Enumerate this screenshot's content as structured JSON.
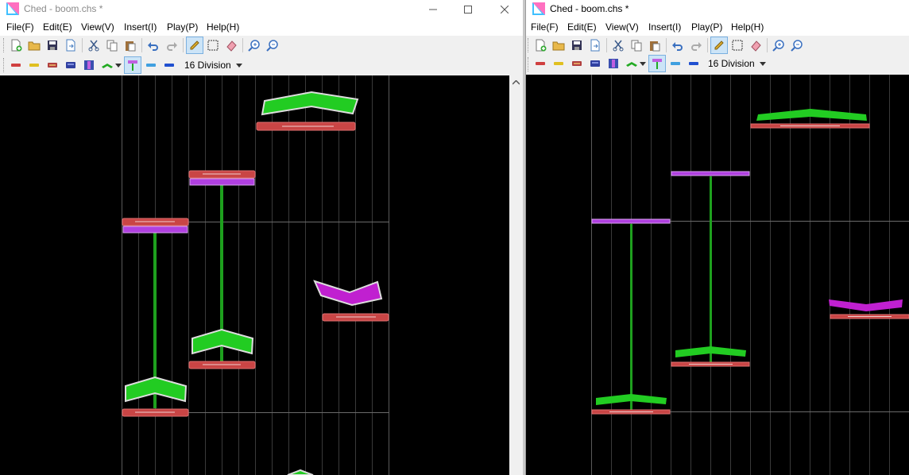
{
  "left": {
    "title": "Ched - boom.chs *",
    "menus": [
      "File(F)",
      "Edit(E)",
      "View(V)",
      "Insert(I)",
      "Play(P)",
      "Help(H)"
    ],
    "division": "16 Division"
  },
  "right": {
    "title": "Ched - boom.chs *",
    "menus": [
      "File(F)",
      "Edit(E)",
      "View(V)",
      "Insert(I)",
      "Play(P)",
      "Help(H)"
    ],
    "division": "16 Division"
  },
  "icons": {
    "toolbar": [
      "new-file-icon",
      "open-folder-icon",
      "save-icon",
      "export-icon",
      "cut-icon",
      "copy-icon",
      "paste-icon",
      "undo-icon",
      "redo-icon",
      "pencil-icon",
      "select-rect-icon",
      "eraser-icon",
      "zoom-in-icon",
      "zoom-out-icon"
    ],
    "notes": [
      "tap-note-icon",
      "extap-note-icon",
      "flick-note-icon",
      "damage-note-icon",
      "hold-note-icon",
      "slide-note-icon",
      "air-note-icon",
      "airaction-note-icon",
      "air-up-icon",
      "air-down-icon"
    ]
  },
  "colors": {
    "note_red": "#c94545",
    "hold_purple": "#b040e0",
    "air_green": "#22cc22",
    "air_down_magenta": "#c020d0",
    "lane_line": "#3a3a3a",
    "bar_line": "#6a6a6a",
    "background": "#000000"
  }
}
